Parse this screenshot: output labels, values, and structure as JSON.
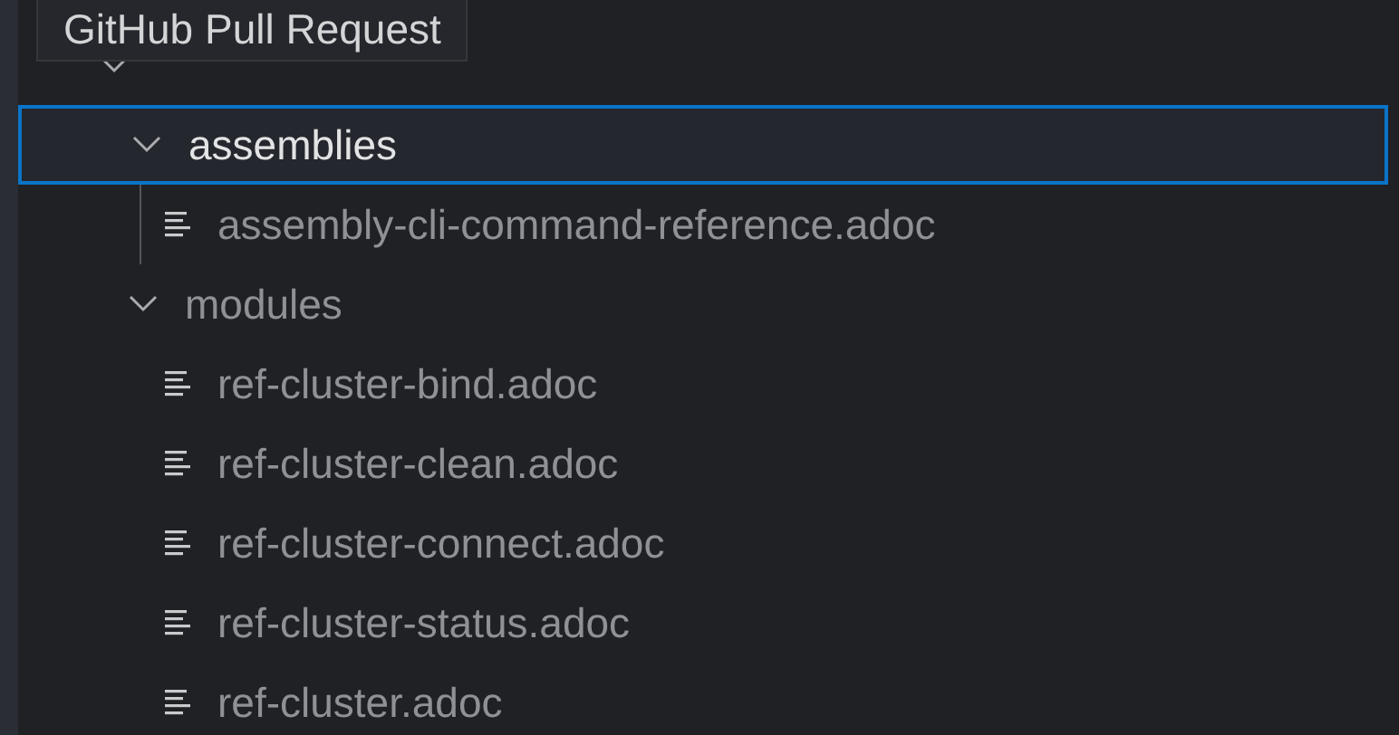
{
  "tooltip": {
    "text": "GitHub Pull Request"
  },
  "tree": [
    {
      "kind": "folder",
      "expanded": true,
      "selected": false,
      "children": [
        {
          "label": "assemblies",
          "kind": "folder",
          "expanded": true,
          "selected": true,
          "children": [
            {
              "label": "assembly-cli-command-reference.adoc",
              "kind": "file",
              "selected": false
            }
          ]
        },
        {
          "label": "modules",
          "kind": "folder",
          "expanded": true,
          "selected": false,
          "children": [
            {
              "label": "ref-cluster-bind.adoc",
              "kind": "file",
              "selected": false
            },
            {
              "label": "ref-cluster-clean.adoc",
              "kind": "file",
              "selected": false
            },
            {
              "label": "ref-cluster-connect.adoc",
              "kind": "file",
              "selected": false
            },
            {
              "label": "ref-cluster-status.adoc",
              "kind": "file",
              "selected": false
            },
            {
              "label": "ref-cluster.adoc",
              "kind": "file",
              "selected": false
            }
          ]
        }
      ]
    }
  ]
}
